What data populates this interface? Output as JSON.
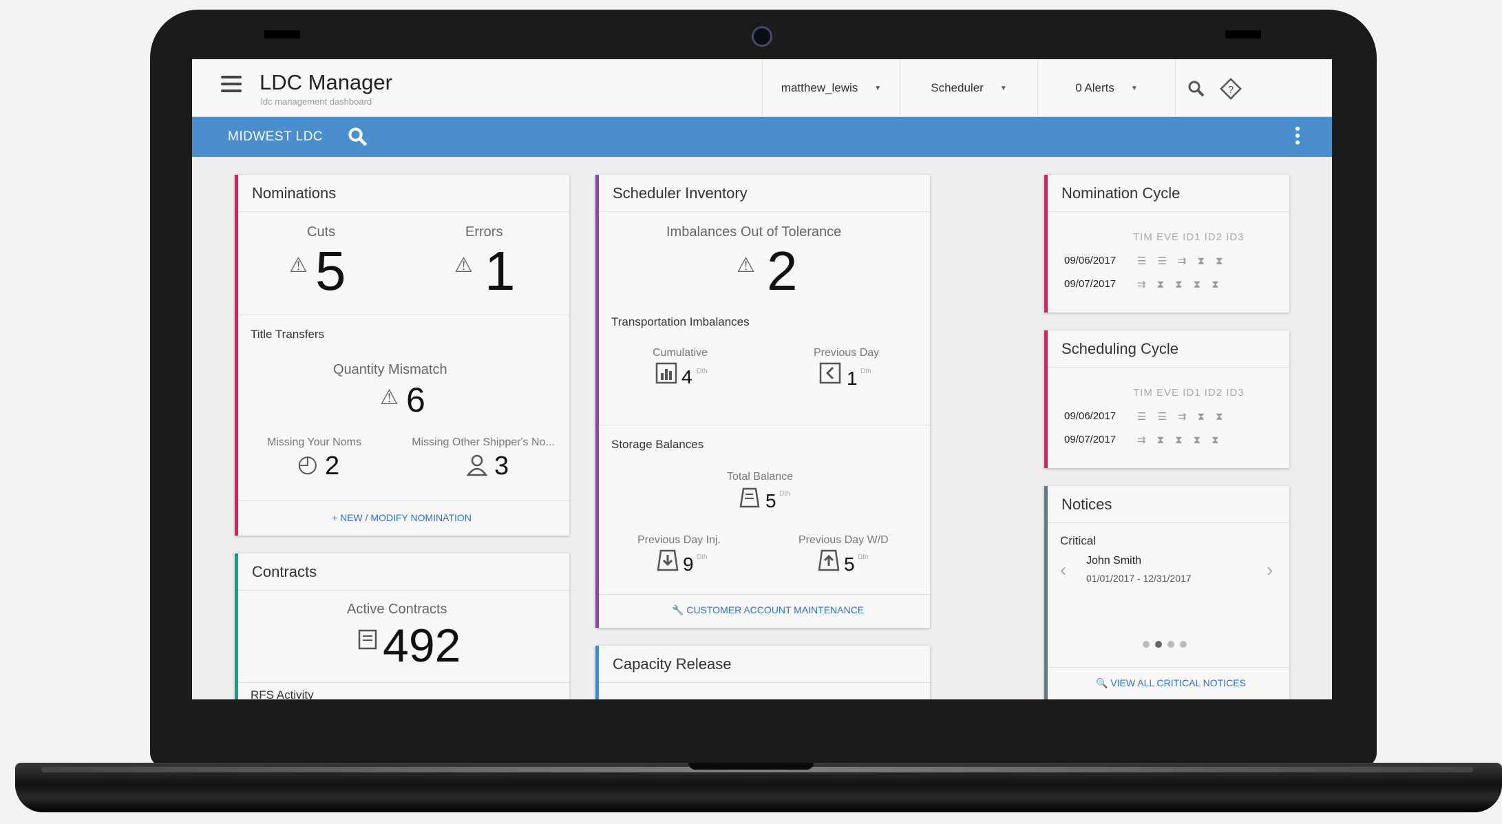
{
  "header": {
    "title": "LDC Manager",
    "subtitle": "ldc management dashboard",
    "user": "matthew_lewis",
    "role": "Scheduler",
    "alerts": "0 Alerts"
  },
  "bluebar": {
    "region": "MIDWEST LDC"
  },
  "nominations": {
    "title": "Nominations",
    "cuts_label": "Cuts",
    "cuts_value": "5",
    "errors_label": "Errors",
    "errors_value": "1",
    "title_transfers": "Title Transfers",
    "qty_mismatch_label": "Quantity Mismatch",
    "qty_mismatch_value": "6",
    "missing_your_label": "Missing Your Noms",
    "missing_your_value": "2",
    "missing_other_label": "Missing Other Shipper's No...",
    "missing_other_value": "3",
    "action": "NEW / MODIFY NOMINATION"
  },
  "contracts": {
    "title": "Contracts",
    "active_label": "Active Contracts",
    "active_value": "492",
    "rfs_label": "RFS Activity"
  },
  "scheduler_inventory": {
    "title": "Scheduler Inventory",
    "imbalances_label": "Imbalances Out of Tolerance",
    "imbalances_value": "2",
    "transport_title": "Transportation Imbalances",
    "cumulative_label": "Cumulative",
    "cumulative_value": "4",
    "prevday_label": "Previous Day",
    "prevday_value": "1",
    "storage_title": "Storage Balances",
    "total_label": "Total Balance",
    "total_value": "5",
    "inj_label": "Previous Day Inj.",
    "inj_value": "9",
    "wd_label": "Previous Day W/D",
    "wd_value": "5",
    "unit": "Dth",
    "action": "CUSTOMER ACCOUNT MAINTENANCE"
  },
  "capacity_release": {
    "title": "Capacity Release"
  },
  "nomination_cycle": {
    "title": "Nomination Cycle",
    "headers": "TIM EVE ID1 ID2 ID3",
    "date1": "09/06/2017",
    "date2": "09/07/2017"
  },
  "scheduling_cycle": {
    "title": "Scheduling Cycle",
    "headers": "TIM EVE ID1 ID2 ID3",
    "date1": "09/06/2017",
    "date2": "09/07/2017"
  },
  "notices": {
    "title": "Notices",
    "level": "Critical",
    "name": "John Smith",
    "dates": "01/01/2017 - 12/31/2017",
    "action": "VIEW ALL CRITICAL NOTICES"
  },
  "colors": {
    "accent_red": "#e8185c",
    "accent_purple": "#8e44ad",
    "accent_teal": "#1a9a8a",
    "accent_blue": "#2f8fe0",
    "bar_blue": "#4a8ecd"
  }
}
